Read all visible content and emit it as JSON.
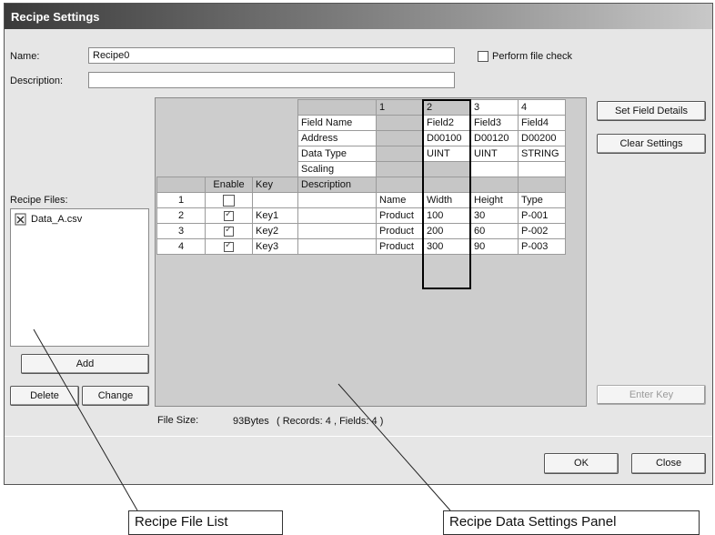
{
  "window": {
    "title": "Recipe Settings"
  },
  "form": {
    "name_label": "Name:",
    "name_value": "Recipe0",
    "description_label": "Description:",
    "description_value": "",
    "perform_check_label": "Perform file check"
  },
  "recipe_files": {
    "label": "Recipe Files:",
    "items": [
      {
        "name": "Data_A.csv",
        "icon": "csv-file-icon"
      }
    ],
    "add_label": "Add",
    "delete_label": "Delete",
    "change_label": "Change"
  },
  "grid": {
    "column_numbers": [
      "1",
      "2",
      "3",
      "4"
    ],
    "field_rows": [
      {
        "label": "Field Name",
        "values": [
          "",
          "Field2",
          "Field3",
          "Field4"
        ]
      },
      {
        "label": "Address",
        "values": [
          "",
          "D00100",
          "D00120",
          "D00200"
        ]
      },
      {
        "label": "Data Type",
        "values": [
          "",
          "UINT",
          "UINT",
          "STRING"
        ]
      },
      {
        "label": "Scaling",
        "values": [
          "",
          "",
          "",
          ""
        ]
      }
    ],
    "header": {
      "enable": "Enable",
      "key": "Key",
      "description": "Description"
    },
    "records": [
      {
        "num": "1",
        "enabled": false,
        "key": "",
        "description": "",
        "values": [
          "Name",
          "Width",
          "Height",
          "Type"
        ]
      },
      {
        "num": "2",
        "enabled": true,
        "key": "Key1",
        "description": "",
        "values": [
          "Product",
          "100",
          "30",
          "P-001"
        ]
      },
      {
        "num": "3",
        "enabled": true,
        "key": "Key2",
        "description": "",
        "values": [
          "Product",
          "200",
          "60",
          "P-002"
        ]
      },
      {
        "num": "4",
        "enabled": true,
        "key": "Key3",
        "description": "",
        "values": [
          "Product",
          "300",
          "90",
          "P-003"
        ]
      }
    ]
  },
  "side_buttons": {
    "set_field_details": "Set Field Details",
    "clear_settings": "Clear Settings",
    "enter_key": "Enter Key"
  },
  "file_size": {
    "label": "File Size:",
    "value": "93Bytes",
    "detail": "( Records: 4 , Fields: 4 )"
  },
  "footer": {
    "ok": "OK",
    "close": "Close"
  },
  "callouts": {
    "file_list": "Recipe File List",
    "data_panel": "Recipe Data Settings Panel"
  }
}
